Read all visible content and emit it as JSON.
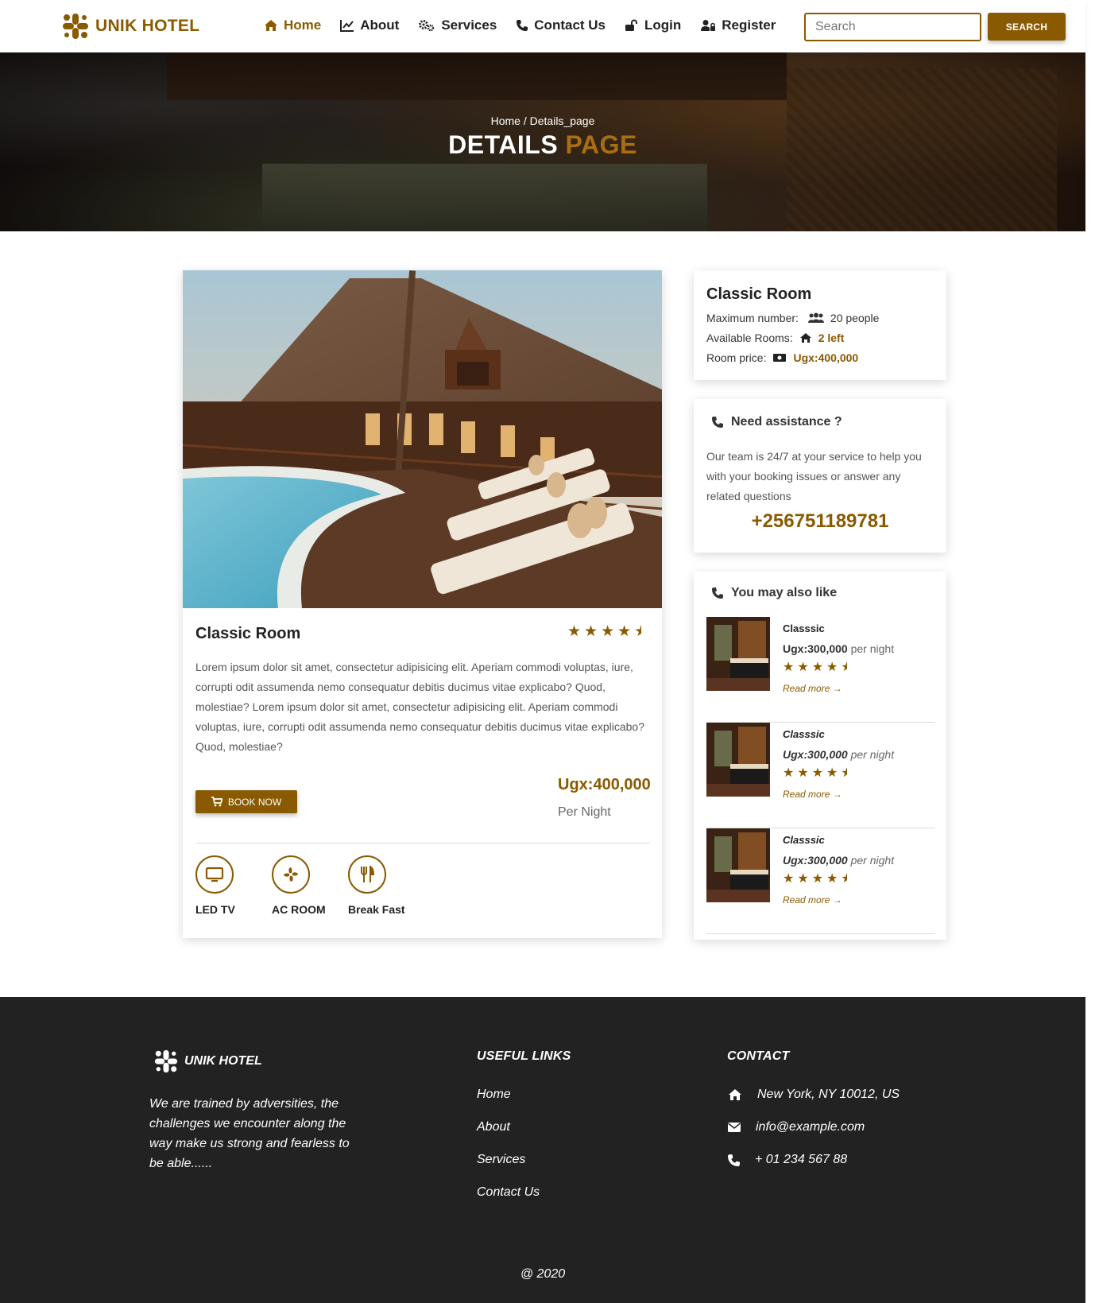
{
  "brand": {
    "name": "UNIK HOTEL",
    "color": "#8a5a00"
  },
  "nav": {
    "items": [
      {
        "label": "Home",
        "icon": "home-icon",
        "active": true
      },
      {
        "label": "About",
        "icon": "chart-line-icon",
        "active": false
      },
      {
        "label": "Services",
        "icon": "gears-icon",
        "active": false
      },
      {
        "label": "Contact Us",
        "icon": "phone-icon",
        "active": false
      },
      {
        "label": "Login",
        "icon": "unlock-icon",
        "active": false
      },
      {
        "label": "Register",
        "icon": "user-lock-icon",
        "active": false
      }
    ],
    "search_placeholder": "Search",
    "search_button": "SEARCH"
  },
  "hero": {
    "breadcrumb": "Home / Details_page",
    "title_main": "DETAILS",
    "title_accent": "PAGE"
  },
  "room": {
    "title": "Classic Room",
    "rating": 4.5,
    "description": "Lorem ipsum dolor sit amet, consectetur adipisicing elit. Aperiam commodi voluptas, iure, corrupti odit assumenda nemo consequatur debitis ducimus vitae explicabo? Quod, molestiae? Lorem ipsum dolor sit amet, consectetur adipisicing elit. Aperiam commodi voluptas, iure, corrupti odit assumenda nemo consequatur debitis ducimus vitae explicabo? Quod, molestiae?",
    "price": "Ugx:400,000",
    "per": "Per Night",
    "book_label": "BOOK NOW",
    "amenities": [
      {
        "label": "LED TV",
        "icon": "tv-icon"
      },
      {
        "label": "AC ROOM",
        "icon": "fan-icon"
      },
      {
        "label": "Break Fast",
        "icon": "utensils-icon"
      }
    ]
  },
  "info": {
    "title": "Classic Room",
    "max_label": "Maximum number:",
    "max_value": "20 people",
    "avail_label": "Available Rooms:",
    "avail_value": "2 left",
    "price_label": "Room price:",
    "price_value": "Ugx:400,000"
  },
  "help": {
    "title": "Need assistance ?",
    "text": "Our team is 24/7 at your service to help you with your booking issues or answer any related questions",
    "phone": "+256751189781"
  },
  "also_like": {
    "title": "You may also like",
    "items": [
      {
        "name": "Classsic",
        "price": "Ugx:300,000",
        "per": "per night",
        "rating": 4.5,
        "read_more": "Read more"
      },
      {
        "name": "Classsic",
        "price": "Ugx:300,000",
        "per": "per night",
        "rating": 4.5,
        "read_more": "Read more"
      },
      {
        "name": "Classsic",
        "price": "Ugx:300,000",
        "per": "per night",
        "rating": 4.5,
        "read_more": "Read more"
      }
    ]
  },
  "footer": {
    "brand": "UNIK HOTEL",
    "about": "We are trained by adversities, the challenges we encounter along the way make us strong and fearless to be able......",
    "links_title": "USEFUL LINKS",
    "links": [
      "Home",
      "About",
      "Services",
      "Contact Us"
    ],
    "contact_title": "CONTACT",
    "address": "New York, NY 10012, US",
    "email": "info@example.com",
    "phone": "+ 01 234 567 88",
    "copyright": "@ 2020"
  }
}
